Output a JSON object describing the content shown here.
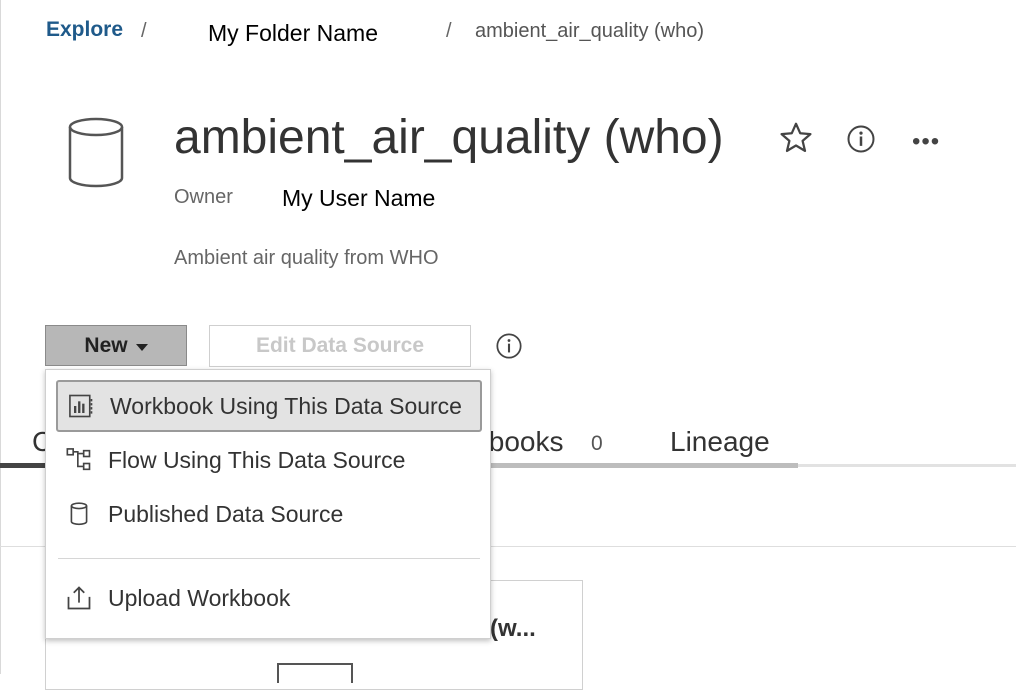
{
  "breadcrumb": {
    "explore": "Explore",
    "separator": "/",
    "folder": "My Folder Name",
    "current": "ambient_air_quality (who)"
  },
  "header": {
    "title": "ambient_air_quality (who)",
    "owner_label": "Owner",
    "owner_name": "My User Name",
    "description": "Ambient air quality from WHO",
    "more": "•••"
  },
  "toolbar": {
    "new_label": "New",
    "edit_label": "Edit Data Source"
  },
  "menu": {
    "items": [
      {
        "label": "Workbook Using This Data Source",
        "icon": "workbook-chart-icon",
        "active": true
      },
      {
        "label": "Flow Using This Data Source",
        "icon": "flow-icon",
        "active": false
      },
      {
        "label": "Published Data Source",
        "icon": "datasource-icon",
        "active": false
      },
      {
        "label": "Upload Workbook",
        "icon": "upload-icon",
        "active": false
      }
    ]
  },
  "tabs": {
    "first_visible": "C",
    "workbooks_visible": "tbooks",
    "workbooks_count": "0",
    "lineage": "Lineage"
  },
  "card": {
    "title_visible": "(w..."
  },
  "colors": {
    "link": "#1f5a8a",
    "button_bg": "#b7b7b7",
    "menu_active_bg": "#e3e3e3"
  }
}
